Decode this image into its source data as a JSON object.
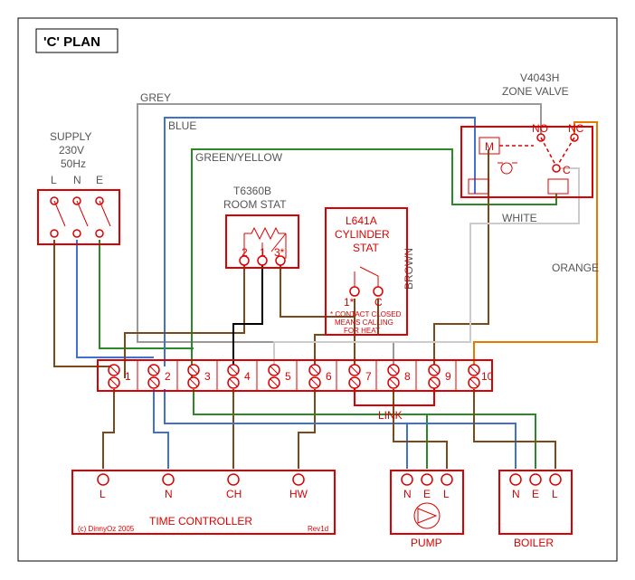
{
  "title": "'C' PLAN",
  "supply": {
    "label": "SUPPLY",
    "voltage": "230V",
    "freq": "50Hz",
    "L": "L",
    "N": "N",
    "E": "E"
  },
  "roomstat": {
    "model": "T6360B",
    "name": "ROOM STAT",
    "t1": "1",
    "t2": "2",
    "t3": "3*"
  },
  "cylstat": {
    "model": "L641A",
    "name": "CYLINDER",
    "name2": "STAT",
    "t1": "1*",
    "tc": "C",
    "note1": "* CONTACT CLOSED",
    "note2": "MEANS CALLING",
    "note3": "FOR HEAT"
  },
  "zone": {
    "model": "V4043H",
    "name": "ZONE VALVE",
    "M": "M",
    "NO": "NO",
    "NC": "NC",
    "C": "C"
  },
  "terminals": [
    "1",
    "2",
    "3",
    "4",
    "5",
    "6",
    "7",
    "8",
    "9",
    "10"
  ],
  "link": "LINK",
  "timectrl": {
    "name": "TIME CONTROLLER",
    "L": "L",
    "N": "N",
    "CH": "CH",
    "HW": "HW"
  },
  "pump": {
    "name": "PUMP",
    "N": "N",
    "E": "E",
    "L": "L"
  },
  "boiler": {
    "name": "BOILER",
    "N": "N",
    "E": "E",
    "L": "L"
  },
  "wirelabels": {
    "grey": "GREY",
    "blue": "BLUE",
    "gy": "GREEN/YELLOW",
    "brown": "BROWN",
    "white": "WHITE",
    "orange": "ORANGE"
  },
  "credit": "(c) DinnyOz 2005",
  "rev": "Rev1d"
}
